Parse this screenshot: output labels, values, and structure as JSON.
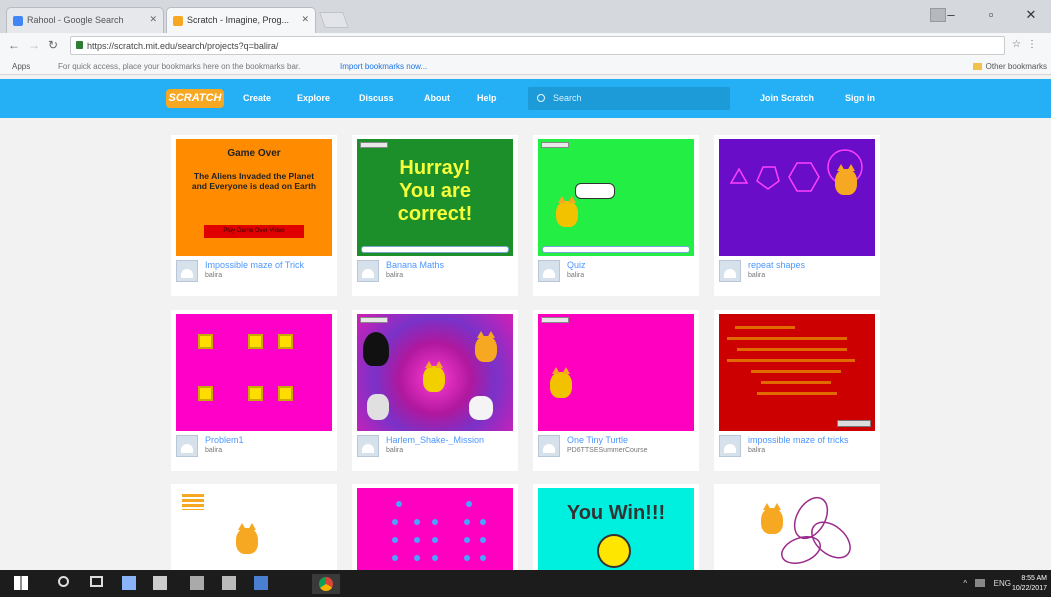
{
  "browser": {
    "tabs": [
      {
        "label": "Rahool - Google Search",
        "favicon_color": "#4285f4"
      },
      {
        "label": "Scratch - Imagine, Prog...",
        "favicon_color": "#f7a823"
      }
    ],
    "url": "https://scratch.mit.edu/search/projects?q=balira/",
    "bookmarks": {
      "apps": "Apps",
      "hint": "For quick access, place your bookmarks here on the bookmarks bar.",
      "import": "Import bookmarks now...",
      "other": "Other bookmarks"
    }
  },
  "scratch_nav": {
    "logo": "SCRATCH",
    "links": [
      "Create",
      "Explore",
      "Discuss",
      "About",
      "Help"
    ],
    "search_placeholder": "Search",
    "join": "Join Scratch",
    "signin": "Sign in"
  },
  "projects": [
    {
      "title": "Impossible maze of Trick",
      "author": "balira",
      "thumb_color": "#ff8c00",
      "thumb_text": {
        "line1": "Game Over",
        "line2": "The Aliens Invaded the Planet and Everyone is dead on Earth",
        "button": "Play Game Over Video"
      }
    },
    {
      "title": "Banana Maths",
      "author": "balira",
      "thumb_color": "#1d8f2a",
      "thumb_text": {
        "big": "Hurray! You are correct!"
      }
    },
    {
      "title": "Quiz",
      "author": "balira",
      "thumb_color": "#22ee44"
    },
    {
      "title": "repeat shapes",
      "author": "balira",
      "thumb_color": "#6a0dc9"
    },
    {
      "title": "Problem1",
      "author": "balira",
      "thumb_color": "#ff00c8"
    },
    {
      "title": "Harlem_Shake-_Mission",
      "author": "balira",
      "thumb_color": "#d21fb6"
    },
    {
      "title": "One Tiny Turtle",
      "author": "PD6TTSESummerCourse",
      "thumb_color": "#ff00c0"
    },
    {
      "title": "impossible maze of tricks",
      "author": "balira",
      "thumb_color": "#cc0000"
    },
    {
      "title": "",
      "author": "",
      "thumb_color": "#ffffff"
    },
    {
      "title": "",
      "author": "",
      "thumb_color": "#ff00c0"
    },
    {
      "title": "",
      "author": "",
      "thumb_color": "#00f0e0",
      "thumb_text": {
        "big": "You Win!!!"
      }
    },
    {
      "title": "",
      "author": "",
      "thumb_color": "#ffffff"
    }
  ],
  "taskbar": {
    "lang": "ENG",
    "time": "8:55 AM",
    "date": "10/22/2017"
  }
}
